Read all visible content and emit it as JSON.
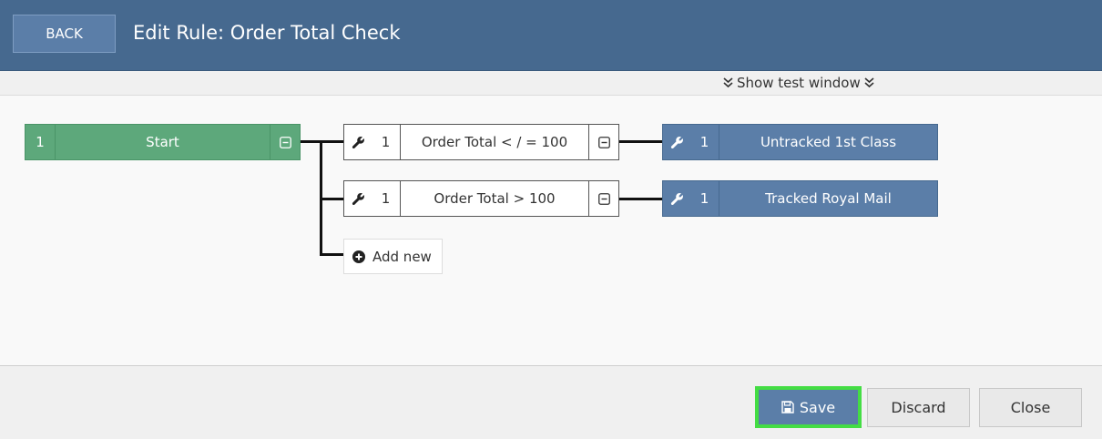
{
  "header": {
    "back_label": "BACK",
    "title": "Edit Rule: Order Total Check"
  },
  "test_window": {
    "label": "Show test window"
  },
  "rule": {
    "start": {
      "number": "1",
      "label": "Start"
    },
    "conditions": [
      {
        "number": "1",
        "label": "Order Total < / = 100"
      },
      {
        "number": "1",
        "label": "Order Total > 100"
      }
    ],
    "actions": [
      {
        "number": "1",
        "label": "Untracked 1st Class"
      },
      {
        "number": "1",
        "label": "Tracked Royal Mail"
      }
    ],
    "add_new_label": "Add new"
  },
  "footer": {
    "save_label": "Save",
    "discard_label": "Discard",
    "close_label": "Close"
  },
  "colors": {
    "header": "#46698f",
    "start_node": "#5da87b",
    "action_node": "#5b7ea8",
    "save_highlight": "#44dd44"
  }
}
